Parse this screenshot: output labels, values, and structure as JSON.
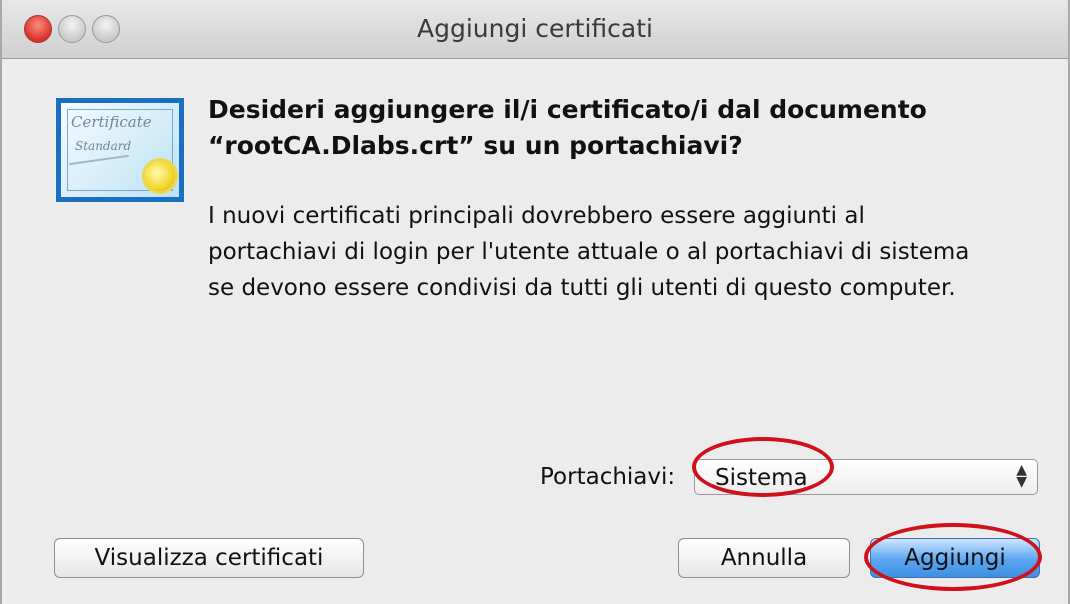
{
  "window": {
    "title": "Aggiungi certificati"
  },
  "icon": {
    "name": "certificate-icon",
    "line1": "Certificate",
    "line2": "Standard"
  },
  "dialog": {
    "heading_line1": "Desideri aggiungere il/i certificato/i dal documento",
    "heading_line2": "“rootCA.Dlabs.crt” su un portachiavi?",
    "body_line1": "I nuovi certificati principali dovrebbero essere aggiunti al",
    "body_line2": "portachiavi di login per l'utente attuale o al portachiavi di sistema",
    "body_line3": "se devono essere condivisi da tutti gli utenti di questo computer."
  },
  "keychain": {
    "label": "Portachiavi:",
    "selected": "Sistema"
  },
  "buttons": {
    "view": "Visualizza certificati",
    "cancel": "Annulla",
    "add": "Aggiungi"
  },
  "colors": {
    "annotation": "#d0101a",
    "primary": "#3f8fe3"
  }
}
